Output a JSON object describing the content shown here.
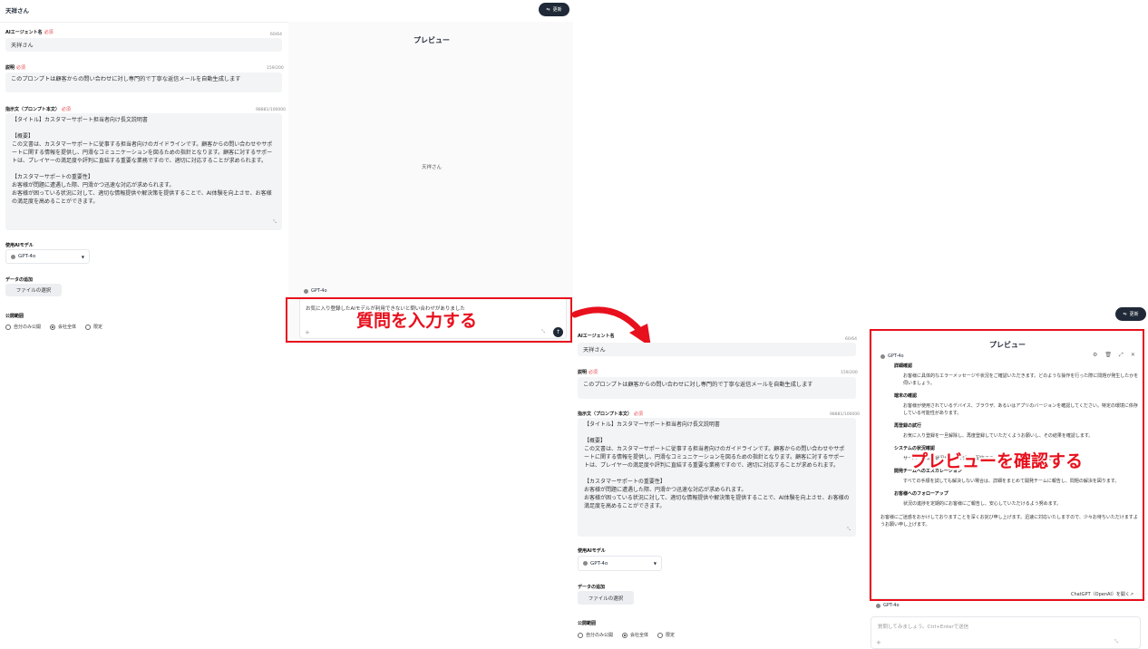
{
  "app_title": "天祥さん",
  "update_label": "更新",
  "form": {
    "agent_name_label": "AIエージェント名",
    "required": "必須",
    "agent_name_count": "60/64",
    "agent_name_value": "天祥さん",
    "description_label": "説明",
    "description_count": "159/200",
    "description_value": "このプロンプトは顧客からの問い合わせに対し専門的で丁寧な返信メールを自動生成します",
    "prompt_label": "指示文（プロンプト本文）",
    "prompt_count": "98881/100000",
    "prompt_value": "【タイトル】カスタマーサポート担当者向け長文説明書\n\n【概要】\nこの文書は、カスタマーサポートに従事する担当者向けのガイドラインです。顧客からの問い合わせやサポートに関する情報を提供し、円滑なコミュニケーションを図るための指針となります。顧客に対するサポートは、プレイヤーの満足度や評判に直結する重要な業務ですので、適切に対応することが求められます。\n\n【カスタマーサポートの重要性】\nお客様が問題に遭遇した際、円滑かつ迅速な対応が求められます。\nお客様が困っている状況に対して、適切な情報提供や解決策を提供することで、AI体験を向上させ、お客様の満足度を高めることができます。",
    "model_label": "使用AIモデル",
    "model_value": "GPT-4o",
    "data_label": "データの追加",
    "file_button": "ファイルの選択",
    "visibility_label": "公開範囲",
    "visibility_options": [
      "自分のみ公開",
      "会社全体",
      "限定"
    ]
  },
  "preview": {
    "title": "プレビュー",
    "agent_name": "天祥さん",
    "model_tag": "GPT-4o",
    "question": "お気に入り登録したAIモデルが利用できないと問い合わせがありました",
    "chat_placeholder": "質問してみましょう。Ctrl+Enterで送信",
    "open_chatgpt": "ChatGPT（OpenAI）を開く"
  },
  "response": {
    "sections": [
      {
        "heading": "詳細確認",
        "body": "お客様に具体的なエラーメッセージや状況をご確認いただきます。どのような操作を行った際に問題が発生したかを伺いましょう。"
      },
      {
        "heading": "端末の確認",
        "body": "お客様が使用されているデバイス、ブラウザ、あるいはアプリのバージョンを確認してください。特定の環境に依存している可能性があります。"
      },
      {
        "heading": "再登録の試行",
        "body": "お気に入り登録を一旦解除し、再度登録していただくようお願いし、その結果を確認します。"
      },
      {
        "heading": "システムの状況確認",
        "body": "サーバーの稼働状況や、AIモデルの配信ステータスに問題がないか確認します。"
      },
      {
        "heading": "開発チームへのエスカレーション",
        "body": "すべての手順を試しても解決しない場合は、詳細をまとめて開発チームに報告し、問題の解決を図ります。"
      },
      {
        "heading": "お客様へのフォローアップ",
        "body": "状況の進捗を定期的にお客様にご報告し、安心していただけるよう努めます。"
      }
    ],
    "closing": "お客様にご迷惑をおかけしておりますことを深くお詫び申し上げます。迅速に対応いたしますので、少々お待ちいただけますようお願い申し上げます。"
  },
  "callouts": {
    "input": "質問を入力する",
    "confirm": "プレビューを確認する"
  },
  "colors": {
    "annotation_red": "#e8101d",
    "dark_button": "#1f2937"
  }
}
